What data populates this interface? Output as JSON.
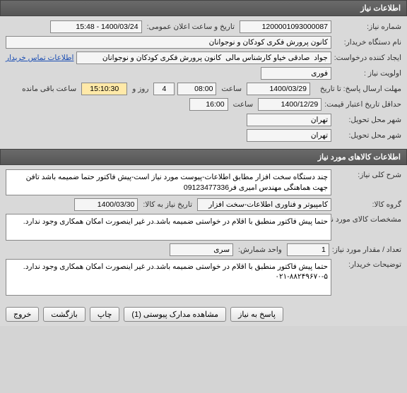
{
  "sections": {
    "need_info": "اطلاعات نیاز",
    "goods_info": "اطلاعات کالاهای مورد نیاز"
  },
  "fields": {
    "need_no_label": "شماره نیاز:",
    "need_no": "1200001093000087",
    "public_announce_label": "تاریخ و ساعت اعلان عمومی:",
    "public_announce": "1400/03/24 - 15:48",
    "buyer_org_label": "نام دستگاه خریدار:",
    "buyer_org": "کانون پرورش فکری کودکان و نوجوانان",
    "requester_label": "ایجاد کننده درخواست:",
    "requester": "جواد  صادقی خیاو کارشناس مالی  کانون پرورش فکری کودکان و نوجوانان",
    "contact_link": "اطلاعات تماس خریدار",
    "priority_label": "اولویت نیاز :",
    "priority": "فوری",
    "deadline_label": "مهلت ارسال پاسخ:  تا تاریخ",
    "deadline_date": "1400/03/29",
    "time_label": "ساعت",
    "deadline_time": "08:00",
    "days": "4",
    "days_label": "روز و",
    "remain_time": "15:10:30",
    "remain_label": "ساعت باقی مانده",
    "validity_label": "حداقل تاریخ اعتبار قیمت:",
    "validity_date": "1400/12/29",
    "validity_time": "16:00",
    "delivery_city_label": "شهر محل تحویل:",
    "delivery_city": "تهران",
    "delivery_addr_label": "شهر محل تحویل:",
    "delivery_addr": "تهران",
    "general_desc_label": "شرح کلی نیاز:",
    "general_desc": "چند دستگاه سخت افزار مطابق اطلاعات-پیوست مورد نیاز است-پیش فاکتور حتما ضمیمه باشد تافن جهت هماهنگی مهندس امیری فر09123477336",
    "goods_group_label": "گروه کالا:",
    "goods_group": "کامپیوتر و فناوری اطلاعات-سخت افزار",
    "goods_date_label": "تاریخ نیاز به کالا:",
    "goods_date": "1400/03/30",
    "goods_spec_label": "مشخصات کالای مورد نیاز:",
    "goods_spec": "حتما پیش فاکتور منطبق با اقلام در خواستی ضمیمه باشد.در غیر اینصورت امکان همکاری وجود ندارد.",
    "qty_label": "تعداد / مقدار مورد نیاز:",
    "qty": "1",
    "unit_label": "واحد شمارش:",
    "unit": "سری",
    "buyer_notes_label": "توضیحات خریدار:",
    "buyer_notes": "حتما پیش فاکتور منطبق با اقلام در خواستی ضمیمه باشد.در غیر اینصورت امکان همکاری وجود ندارد.\n۰۲۱-۸۸۲۴۹۶۷۰-۵"
  },
  "buttons": {
    "respond": "پاسخ به نیاز",
    "attachments": "مشاهده مدارک پیوستی  (1)",
    "print": "چاپ",
    "back": "بازگشت",
    "exit": "خروج"
  }
}
